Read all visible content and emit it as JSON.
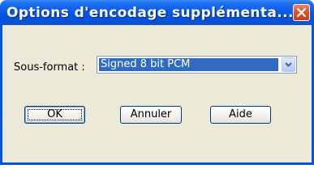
{
  "window": {
    "title": "Options d'encodage supplémenta...",
    "close_icon": "close-icon"
  },
  "form": {
    "subformat_label": "Sous-format :",
    "subformat_value": "Signed 8 bit PCM",
    "dropdown_icon": "chevron-down-icon"
  },
  "buttons": {
    "ok": "OK",
    "cancel": "Annuler",
    "help": "Aide"
  },
  "colors": {
    "titlebar": "#0a5ce8",
    "close": "#d9542e",
    "selection": "#316ac5",
    "client": "#ece9d8"
  }
}
